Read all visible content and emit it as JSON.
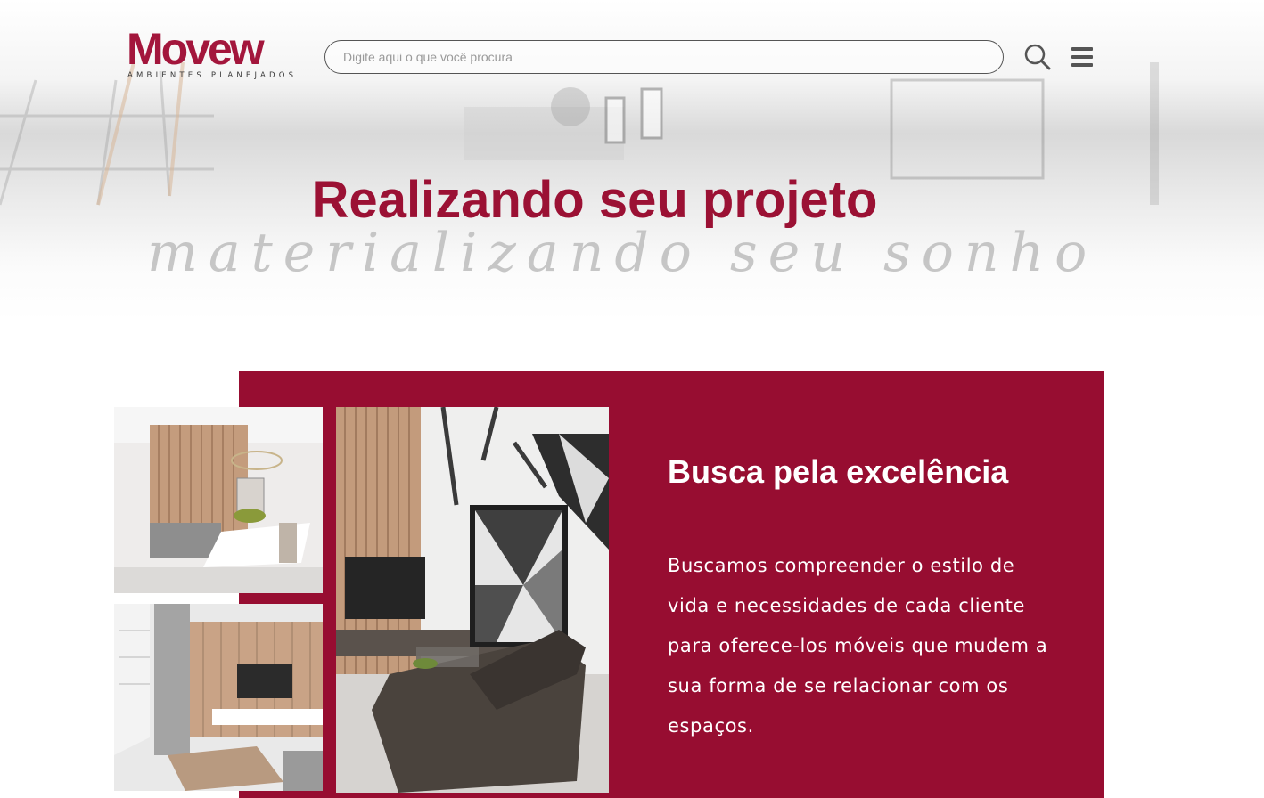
{
  "brand": {
    "logo_word": "Movew",
    "logo_tagline": "AMBIENTES PLANEJADOS",
    "primary_color": "#970d31",
    "logo_color": "#a3163c"
  },
  "header": {
    "search_placeholder": "Digite aqui o que você procura",
    "search_icon": "search-icon",
    "menu_icon": "hamburger-menu-icon"
  },
  "hero": {
    "title": "Realizando seu projeto",
    "script_line": "materializando seu sonho"
  },
  "feature": {
    "title": "Busca pela excelência",
    "body": "Buscamos compreender o estilo de vida e necessidades de cada cliente para oferece-los móveis que mudem a sua forma de se relacionar com os espaços."
  },
  "gallery": {
    "images": [
      "dining-room-photo",
      "living-room-tv-wall-photo",
      "living-room-sofa-photo"
    ]
  }
}
